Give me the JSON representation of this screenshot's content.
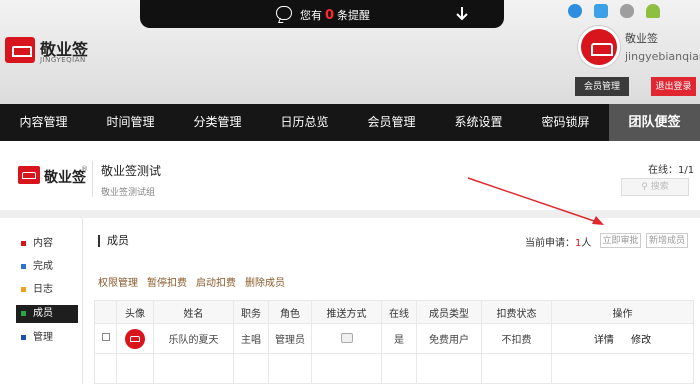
{
  "notification": {
    "prefix": "您有",
    "count": "0",
    "suffix": "条提醒"
  },
  "brand": {
    "name": "敬业签",
    "pinyin": "JINGYEQIAN",
    "registered": "®"
  },
  "user": {
    "name": "敬业签",
    "pinyin": "jingyebianqian",
    "member_btn": "会员管理",
    "logout_btn": "退出登录"
  },
  "nav": {
    "items": [
      "内容管理",
      "时间管理",
      "分类管理",
      "日历总览",
      "会员管理",
      "系统设置",
      "密码锁屏"
    ],
    "active": "团队便签"
  },
  "project": {
    "title": "敬业签测试",
    "desc": "敬业签测试组",
    "online_label": "在线：1/1",
    "search_placeholder": "搜索"
  },
  "sidebar": {
    "items": [
      {
        "label": "内容",
        "color": "#d8141c"
      },
      {
        "label": "完成",
        "color": "#2f6fd8"
      },
      {
        "label": "日志",
        "color": "#f0a020"
      },
      {
        "label": "成员",
        "color": "#27a844"
      },
      {
        "label": "管理",
        "color": "#1f4fb4"
      }
    ]
  },
  "members": {
    "title": "成员",
    "pending_label": "当前申请：",
    "pending_count": "1",
    "pending_unit": "人",
    "approve_btn": "立即审批",
    "add_btn": "新增成员",
    "actions": [
      "权限管理",
      "暂停扣费",
      "启动扣费",
      "删除成员"
    ],
    "columns": [
      "头像",
      "姓名",
      "职务",
      "角色",
      "推送方式",
      "在线",
      "成员类型",
      "扣费状态",
      "操作"
    ],
    "rows": [
      {
        "name": "乐队的夏天",
        "position": "主唱",
        "role": "管理员",
        "online": "是",
        "type": "免费用户",
        "billing": "不扣费",
        "detail": "详情",
        "edit": "修改"
      }
    ]
  }
}
